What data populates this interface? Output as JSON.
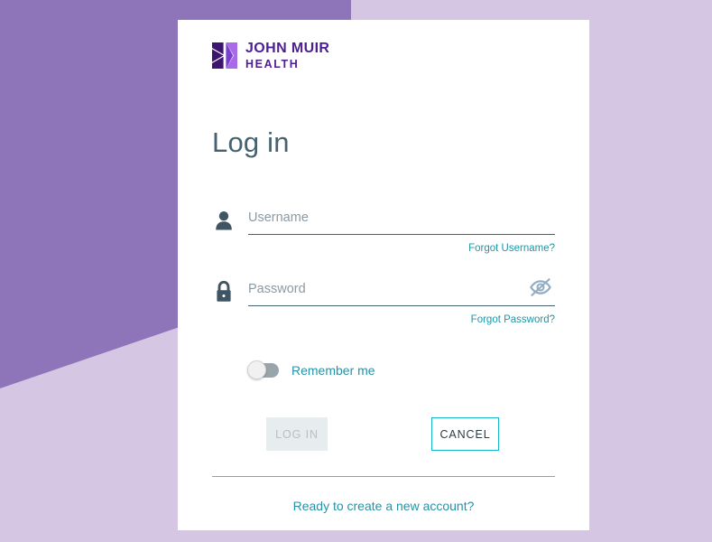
{
  "brand": {
    "logo_icon": "john-muir-butterfly-mark",
    "name_line1": "JOHN MUIR",
    "name_line2": "HEALTH",
    "logo_color": "#4b1f91",
    "logo_color_light": "#a96ae8"
  },
  "background": {
    "band_color": "#8e74b8",
    "base_color": "#d5c6e4",
    "card_color": "#ffffff"
  },
  "page": {
    "heading": "Log in"
  },
  "form": {
    "username": {
      "icon": "person-icon",
      "value": "",
      "placeholder": "Username",
      "forgot_label": "Forgot Username?"
    },
    "password": {
      "icon": "lock-icon",
      "value": "",
      "placeholder": "Password",
      "reveal_icon": "eye-slash-icon",
      "forgot_label": "Forgot Password?"
    },
    "remember": {
      "label": "Remember me",
      "checked": false
    }
  },
  "actions": {
    "login_label": "LOG IN",
    "login_disabled": true,
    "cancel_label": "CANCEL"
  },
  "footer": {
    "create_account_label": "Ready to create a new account?"
  },
  "colors": {
    "accent_teal": "#18b6c9",
    "link_teal": "#2593a6",
    "text_slate": "#46616f",
    "placeholder_gray": "#8a9aa4"
  }
}
